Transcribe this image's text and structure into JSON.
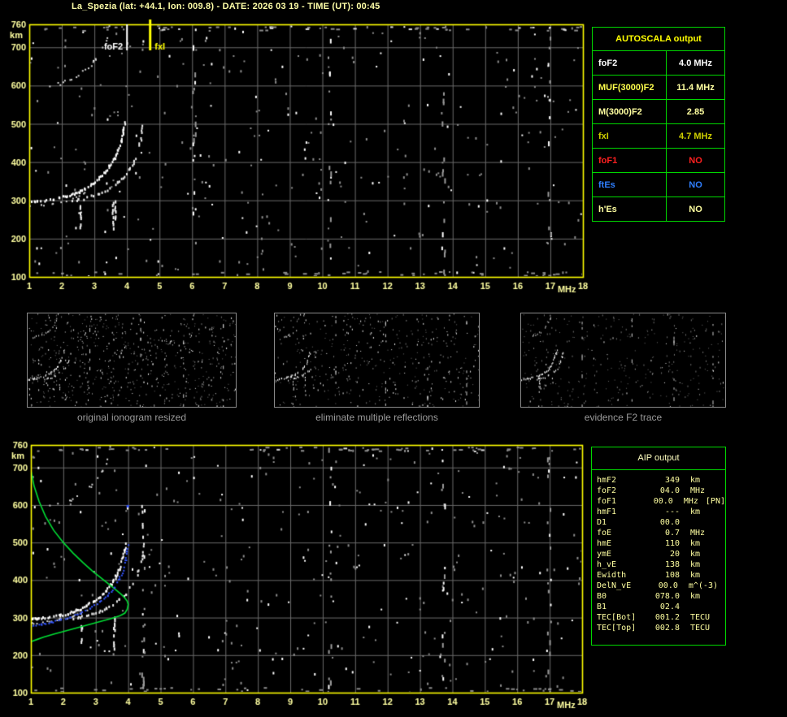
{
  "header": {
    "title": "La_Spezia (lat: +44.1, lon: 009.8) - DATE: 2026 03 19 - TIME (UT): 00:45"
  },
  "colors": {
    "frame_yellow": "#ffff00",
    "label_yellow": "#ffffa0",
    "grid_gray": "#6a6a6a",
    "table_green": "#00d800",
    "trace_white": "#ffffff",
    "profile_green": "#00dd33",
    "fit_blue": "#3355ff",
    "caption_gray": "#9a9a9a",
    "status_red": "#ff2020",
    "status_blue": "#2f7fff"
  },
  "autoscala_table": {
    "header": "AUTOSCALA output",
    "rows": [
      {
        "param": "foF2",
        "value": "4.0 MHz",
        "param_color": "#ffffff",
        "value_color": "#ffffff"
      },
      {
        "param": "MUF(3000)F2",
        "value": "11.4 MHz",
        "param_color": "#ffff4d",
        "value_color": "#ffffa0"
      },
      {
        "param": "M(3000)F2",
        "value": "2.85",
        "param_color": "#ffffa0",
        "value_color": "#ffffa0"
      },
      {
        "param": "fxI",
        "value": "4.7 MHz",
        "param_color": "#cfcf00",
        "value_color": "#cfcf00"
      },
      {
        "param": "foF1",
        "value": "NO",
        "param_color": "#ff2020",
        "value_color": "#ff2020"
      },
      {
        "param": "ftEs",
        "value": "NO",
        "param_color": "#2f7fff",
        "value_color": "#2f7fff"
      },
      {
        "param": "h'Es",
        "value": "NO",
        "param_color": "#ffffa0",
        "value_color": "#ffffa0"
      }
    ]
  },
  "aip_table": {
    "header": "AIP output",
    "rows": [
      {
        "name": "hmF2",
        "value": "349",
        "unit": "km",
        "extra": ""
      },
      {
        "name": "foF2",
        "value": "04.0",
        "unit": "MHz",
        "extra": ""
      },
      {
        "name": "foF1",
        "value": "00.0",
        "unit": "MHz",
        "extra": "[PN]"
      },
      {
        "name": "hmF1",
        "value": "---",
        "unit": "km",
        "extra": ""
      },
      {
        "name": "D1",
        "value": "00.0",
        "unit": "",
        "extra": ""
      },
      {
        "name": "foE",
        "value": "0.7",
        "unit": "MHz",
        "extra": ""
      },
      {
        "name": "hmE",
        "value": "110",
        "unit": "km",
        "extra": ""
      },
      {
        "name": "ymE",
        "value": "20",
        "unit": "km",
        "extra": ""
      },
      {
        "name": "h_vE",
        "value": "138",
        "unit": "km",
        "extra": ""
      },
      {
        "name": "Ewidth",
        "value": "108",
        "unit": "km",
        "extra": ""
      },
      {
        "name": "DelN_vE",
        "value": "00.0",
        "unit": "m^(-3)",
        "extra": ""
      },
      {
        "name": "B0",
        "value": "078.0",
        "unit": "km",
        "extra": ""
      },
      {
        "name": "B1",
        "value": "02.4",
        "unit": "",
        "extra": ""
      },
      {
        "name": "TEC[Bot]",
        "value": "001.2",
        "unit": "TECU",
        "extra": ""
      },
      {
        "name": "TEC[Top]",
        "value": "002.8",
        "unit": "TECU",
        "extra": ""
      }
    ]
  },
  "thumbnails": [
    {
      "caption": "original ionogram resized"
    },
    {
      "caption": "eliminate multiple reflections"
    },
    {
      "caption": "evidence F2 trace"
    }
  ],
  "chart_data": [
    {
      "id": "top_ionogram",
      "type": "scatter",
      "title": "scaled ionogram with AUTOSCALA frequency markers",
      "xlabel": "MHz",
      "ylabel": "km",
      "xlim": [
        1,
        18
      ],
      "ylim": [
        100,
        760
      ],
      "x_ticks": [
        1,
        2,
        3,
        4,
        5,
        6,
        7,
        8,
        9,
        10,
        11,
        12,
        13,
        14,
        15,
        16,
        17,
        18
      ],
      "y_ticks": [
        760,
        700,
        600,
        500,
        400,
        300,
        200,
        100
      ],
      "grid": true,
      "markers": [
        {
          "label": "foF2",
          "freq": 4.0,
          "color": "#ffffff",
          "label_side": "left"
        },
        {
          "label": "fxI",
          "freq": 4.7,
          "color": "#ffff00",
          "label_side": "right"
        }
      ],
      "series": [
        {
          "name": "f2_ordinary_trace",
          "color": "#ffffff",
          "points": [
            [
              1.0,
              298
            ],
            [
              1.15,
              300
            ],
            [
              1.3,
              301
            ],
            [
              1.5,
              303
            ],
            [
              1.7,
              306
            ],
            [
              1.9,
              309
            ],
            [
              2.1,
              313
            ],
            [
              2.3,
              318
            ],
            [
              2.5,
              325
            ],
            [
              2.7,
              334
            ],
            [
              2.9,
              345
            ],
            [
              3.1,
              358
            ],
            [
              3.3,
              374
            ],
            [
              3.45,
              392
            ],
            [
              3.6,
              413
            ],
            [
              3.7,
              432
            ],
            [
              3.8,
              456
            ],
            [
              3.87,
              480
            ],
            [
              3.92,
              505
            ]
          ]
        },
        {
          "name": "f2_extraordinary_trace",
          "color": "#e8e8e8",
          "points": [
            [
              2.3,
              300
            ],
            [
              2.5,
              304
            ],
            [
              2.7,
              308
            ],
            [
              2.9,
              313
            ],
            [
              3.1,
              319
            ],
            [
              3.3,
              327
            ],
            [
              3.5,
              337
            ],
            [
              3.7,
              350
            ],
            [
              3.9,
              366
            ],
            [
              4.05,
              384
            ],
            [
              4.2,
              405
            ],
            [
              4.3,
              428
            ],
            [
              4.38,
              452
            ],
            [
              4.44,
              478
            ],
            [
              4.47,
              500
            ]
          ]
        },
        {
          "name": "second_hop_trace",
          "color": "#d0d0d0",
          "points": [
            [
              1.6,
              600
            ],
            [
              1.9,
              606
            ],
            [
              2.2,
              615
            ],
            [
              2.5,
              628
            ],
            [
              2.8,
              648
            ],
            [
              3.0,
              668
            ],
            [
              3.2,
              695
            ],
            [
              3.35,
              725
            ],
            [
              3.45,
              758
            ]
          ]
        }
      ],
      "vertical_streaks": [
        [
          2.55,
          232,
          288
        ],
        [
          3.55,
          222,
          302
        ],
        [
          3.62,
          255,
          300
        ]
      ],
      "rfi_columns": [
        6.05,
        10.2,
        13.7,
        16.95
      ],
      "noise_count": 340,
      "seed": 11
    },
    {
      "id": "bottom_ionogram",
      "type": "scatter",
      "title": "ionogram with AIP fitted trace and electron density profile",
      "xlabel": "MHz",
      "ylabel": "km",
      "xlim": [
        1,
        18
      ],
      "ylim": [
        100,
        760
      ],
      "x_ticks": [
        1,
        2,
        3,
        4,
        5,
        6,
        7,
        8,
        9,
        10,
        11,
        12,
        13,
        14,
        15,
        16,
        17,
        18
      ],
      "y_ticks": [
        760,
        700,
        600,
        500,
        400,
        300,
        200,
        100
      ],
      "grid": true,
      "series": [
        {
          "name": "f2_ordinary_trace",
          "color": "#ffffff",
          "points": [
            [
              1.0,
              298
            ],
            [
              1.15,
              300
            ],
            [
              1.3,
              301
            ],
            [
              1.5,
              303
            ],
            [
              1.7,
              306
            ],
            [
              1.9,
              309
            ],
            [
              2.1,
              313
            ],
            [
              2.3,
              318
            ],
            [
              2.5,
              325
            ],
            [
              2.7,
              334
            ],
            [
              2.9,
              345
            ],
            [
              3.1,
              358
            ],
            [
              3.3,
              374
            ],
            [
              3.45,
              392
            ],
            [
              3.6,
              413
            ],
            [
              3.7,
              432
            ],
            [
              3.8,
              456
            ],
            [
              3.87,
              480
            ],
            [
              3.92,
              505
            ]
          ]
        },
        {
          "name": "f2_extraordinary_trace",
          "color": "#e8e8e8",
          "points": [
            [
              2.3,
              300
            ],
            [
              2.5,
              304
            ],
            [
              2.7,
              308
            ],
            [
              2.9,
              313
            ],
            [
              3.1,
              319
            ],
            [
              3.3,
              327
            ],
            [
              3.5,
              337
            ],
            [
              3.7,
              350
            ],
            [
              3.9,
              366
            ],
            [
              4.05,
              384
            ],
            [
              4.2,
              405
            ],
            [
              4.3,
              428
            ],
            [
              4.38,
              452
            ],
            [
              4.44,
              478
            ],
            [
              4.47,
              500
            ]
          ]
        },
        {
          "name": "second_hop_trace",
          "color": "#d0d0d0",
          "points": [
            [
              1.6,
              600
            ],
            [
              1.9,
              606
            ],
            [
              2.2,
              615
            ],
            [
              2.5,
              628
            ],
            [
              2.8,
              648
            ],
            [
              3.0,
              668
            ],
            [
              3.2,
              695
            ],
            [
              3.35,
              725
            ],
            [
              3.45,
              758
            ]
          ]
        }
      ],
      "profile_green": [
        [
          1.0,
          692
        ],
        [
          1.1,
          650
        ],
        [
          1.25,
          610
        ],
        [
          1.45,
          570
        ],
        [
          1.7,
          533
        ],
        [
          2.0,
          500
        ],
        [
          2.3,
          472
        ],
        [
          2.6,
          447
        ],
        [
          2.9,
          424
        ],
        [
          3.2,
          403
        ],
        [
          3.45,
          386
        ],
        [
          3.65,
          372
        ],
        [
          3.8,
          361
        ],
        [
          3.9,
          352
        ],
        [
          3.97,
          344
        ],
        [
          4.0,
          335
        ],
        [
          3.97,
          322
        ],
        [
          3.9,
          312
        ],
        [
          3.75,
          305
        ],
        [
          3.5,
          298
        ],
        [
          3.2,
          291
        ],
        [
          2.9,
          284
        ],
        [
          2.6,
          277
        ],
        [
          2.3,
          270
        ],
        [
          2.0,
          263
        ],
        [
          1.7,
          256
        ],
        [
          1.4,
          248
        ],
        [
          1.2,
          242
        ],
        [
          1.0,
          236
        ]
      ],
      "fitted_trace_blue": [
        [
          1.0,
          278
        ],
        [
          1.3,
          283
        ],
        [
          1.6,
          289
        ],
        [
          1.9,
          296
        ],
        [
          2.2,
          304
        ],
        [
          2.5,
          314
        ],
        [
          2.8,
          327
        ],
        [
          3.1,
          343
        ],
        [
          3.35,
          361
        ],
        [
          3.55,
          381
        ],
        [
          3.7,
          403
        ],
        [
          3.82,
          428
        ],
        [
          3.9,
          455
        ],
        [
          3.95,
          478
        ],
        [
          3.98,
          495
        ]
      ],
      "blue_outlier": [
        3.95,
        600
      ],
      "vertical_streaks": [
        [
          2.55,
          232,
          288
        ],
        [
          3.55,
          222,
          302
        ],
        [
          4.42,
          520,
          600
        ]
      ],
      "rfi_columns": [
        4.45,
        10.2,
        13.7,
        16.95
      ],
      "noise_count": 340,
      "seed": 22
    },
    {
      "id": "thumb_original",
      "type": "scatter",
      "title": "original ionogram resized",
      "noise_count": 680,
      "seed": 31,
      "noise_bright": 0.45
    },
    {
      "id": "thumb_eliminate",
      "type": "scatter",
      "title": "eliminate multiple reflections",
      "noise_count": 430,
      "seed": 32,
      "noise_bright": 0.4
    },
    {
      "id": "thumb_evidence",
      "type": "scatter",
      "title": "evidence F2 trace",
      "noise_count": 360,
      "seed": 33,
      "noise_bright": 0.15
    }
  ]
}
